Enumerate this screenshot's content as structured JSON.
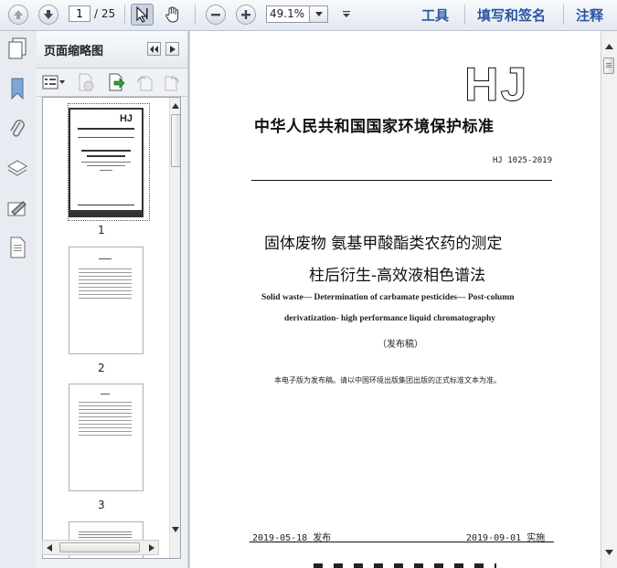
{
  "toolbar": {
    "page_current": "1",
    "page_total": "/ 25",
    "zoom": "49.1%",
    "tools_label": "工具",
    "sign_label": "填写和签名",
    "comment_label": "注释"
  },
  "panel": {
    "title": "页面缩略图",
    "thumbnails": [
      {
        "label": "1",
        "selected": true
      },
      {
        "label": "2",
        "selected": false
      },
      {
        "label": "3",
        "selected": false
      }
    ],
    "thumb1_logo": "HJ"
  },
  "document": {
    "logo": "HJ",
    "standard_heading": "中华人民共和国国家环境保护标准",
    "standard_number": "HJ 1025-2019",
    "title_line1": "固体废物 氨基甲酸酯类农药的测定",
    "title_line2": "柱后衍生-高效液相色谱法",
    "english_line1": "Solid waste— Determination of carbamate pesticides— Post-column",
    "english_line2": "derivatization- high performance liquid chromatography",
    "version": "（发布稿）",
    "note": "本电子版为发布稿。请以中国环境出版集团出版的正式标准文本为准。",
    "issue_date": "2019-05-18 发布",
    "effective_date": "2019-09-01 实施"
  }
}
